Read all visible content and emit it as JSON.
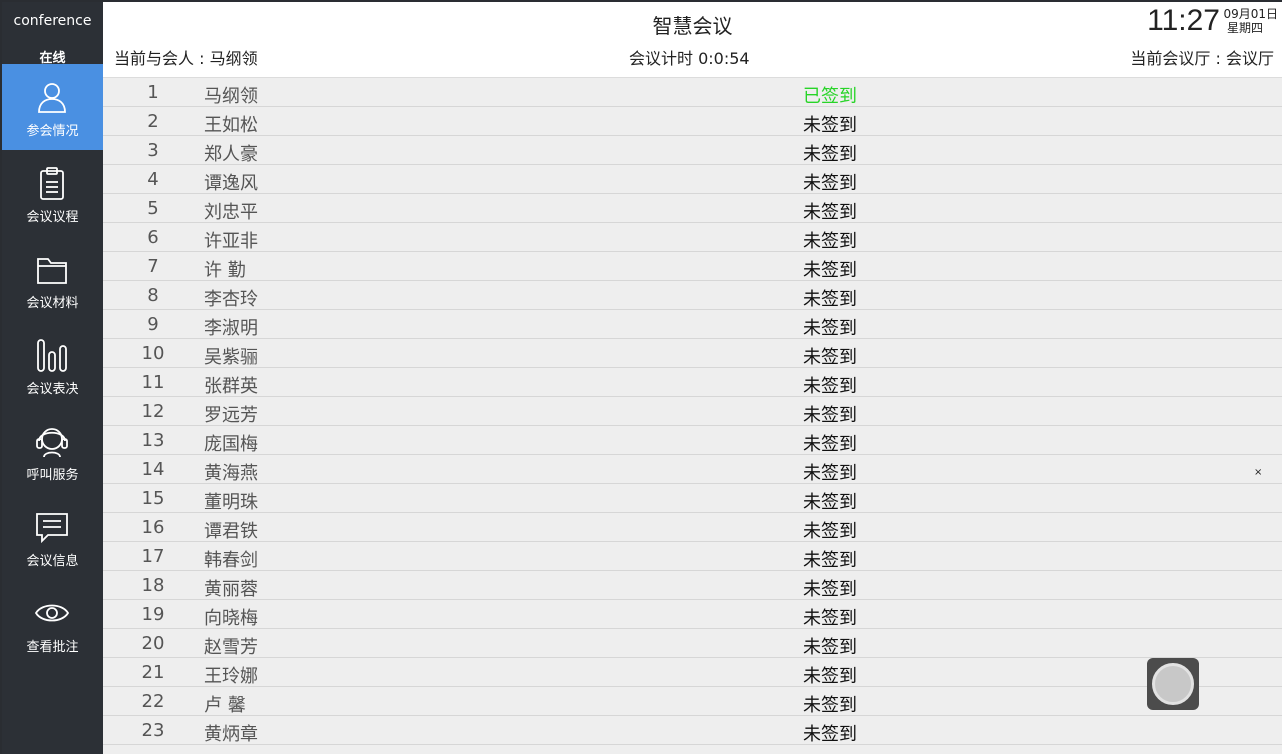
{
  "sidebar": {
    "brand": "conference",
    "status": "在线",
    "items": [
      {
        "label": "参会情况",
        "icon": "person-icon",
        "active": true
      },
      {
        "label": "会议议程",
        "icon": "clipboard-icon",
        "active": false
      },
      {
        "label": "会议材料",
        "icon": "folder-icon",
        "active": false
      },
      {
        "label": "会议表决",
        "icon": "bar-vote-icon",
        "active": false
      },
      {
        "label": "呼叫服务",
        "icon": "headset-icon",
        "active": false
      },
      {
        "label": "会议信息",
        "icon": "message-icon",
        "active": false
      },
      {
        "label": "查看批注",
        "icon": "eye-icon",
        "active": false
      }
    ]
  },
  "header": {
    "title": "智慧会议",
    "attendee": "当前与会人 : 马纲领",
    "timer": "会议计时 0:0:54",
    "hall": "当前会议厅 : 会议厅",
    "clock": "11:27",
    "date": "09月01日",
    "weekday": "星期四"
  },
  "attendees": [
    {
      "num": "1",
      "name": "马纲领",
      "status": "已签到",
      "signed": true
    },
    {
      "num": "2",
      "name": "王如松",
      "status": "未签到",
      "signed": false
    },
    {
      "num": "3",
      "name": "郑人豪",
      "status": "未签到",
      "signed": false
    },
    {
      "num": "4",
      "name": "谭逸风",
      "status": "未签到",
      "signed": false
    },
    {
      "num": "5",
      "name": "刘忠平",
      "status": "未签到",
      "signed": false
    },
    {
      "num": "6",
      "name": "许亚非",
      "status": "未签到",
      "signed": false
    },
    {
      "num": "7",
      "name": "许 勤",
      "status": "未签到",
      "signed": false
    },
    {
      "num": "8",
      "name": "李杏玲",
      "status": "未签到",
      "signed": false
    },
    {
      "num": "9",
      "name": "李淑明",
      "status": "未签到",
      "signed": false
    },
    {
      "num": "10",
      "name": "吴紫骊",
      "status": "未签到",
      "signed": false
    },
    {
      "num": "11",
      "name": "张群英",
      "status": "未签到",
      "signed": false
    },
    {
      "num": "12",
      "name": "罗远芳",
      "status": "未签到",
      "signed": false
    },
    {
      "num": "13",
      "name": "庞国梅",
      "status": "未签到",
      "signed": false
    },
    {
      "num": "14",
      "name": "黄海燕",
      "status": "未签到",
      "signed": false
    },
    {
      "num": "15",
      "name": "董明珠",
      "status": "未签到",
      "signed": false
    },
    {
      "num": "16",
      "name": "谭君铁",
      "status": "未签到",
      "signed": false
    },
    {
      "num": "17",
      "name": "韩春剑",
      "status": "未签到",
      "signed": false
    },
    {
      "num": "18",
      "name": "黄丽蓉",
      "status": "未签到",
      "signed": false
    },
    {
      "num": "19",
      "name": "向晓梅",
      "status": "未签到",
      "signed": false
    },
    {
      "num": "20",
      "name": "赵雪芳",
      "status": "未签到",
      "signed": false
    },
    {
      "num": "21",
      "name": "王玲娜",
      "status": "未签到",
      "signed": false
    },
    {
      "num": "22",
      "name": "卢 馨",
      "status": "未签到",
      "signed": false
    },
    {
      "num": "23",
      "name": "黄炳章",
      "status": "未签到",
      "signed": false
    }
  ],
  "overlay": {
    "close_glyph": "×"
  },
  "colors": {
    "sidebar_bg": "#2c3036",
    "active_bg": "#4a90e2",
    "signed_green": "#27d427",
    "list_bg": "#eeeeee"
  }
}
